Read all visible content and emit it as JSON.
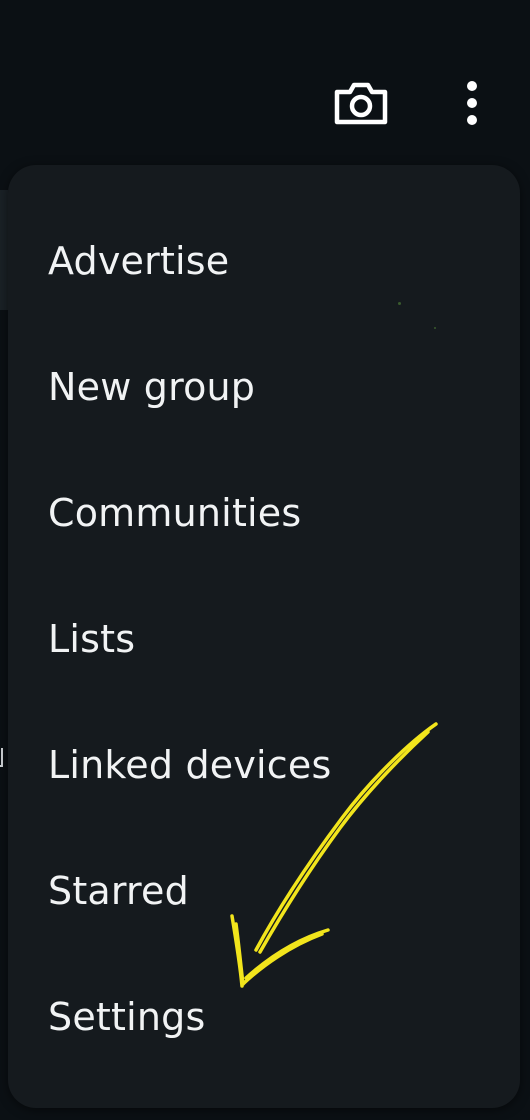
{
  "top_bar": {
    "icons": [
      "camera-icon",
      "more-vert-icon"
    ],
    "icon_color": "#ffffff"
  },
  "menu": {
    "background": "#151a1e",
    "items": [
      {
        "label": "Advertise"
      },
      {
        "label": "New group"
      },
      {
        "label": "Communities"
      },
      {
        "label": "Lists"
      },
      {
        "label": "Linked devices"
      },
      {
        "label": "Starred"
      },
      {
        "label": "Settings"
      }
    ]
  },
  "annotation": {
    "type": "hand-drawn arrow",
    "color": "#f2e51c",
    "points_to": "Settings"
  }
}
